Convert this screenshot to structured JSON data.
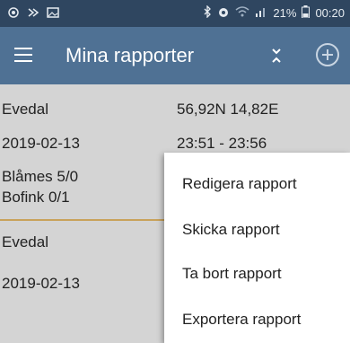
{
  "status_bar": {
    "battery": "21%",
    "time": "00:20",
    "left_icons": [
      "camera-icon",
      "nfc-icon",
      "image-icon"
    ],
    "right_icons": [
      "bluetooth-icon",
      "alarm-icon",
      "wifi-icon",
      "signal-icon",
      "battery-icon"
    ]
  },
  "appbar": {
    "title": "Mina rapporter",
    "menu_icon": "hamburger-menu-icon",
    "sort_icon": "collapse-expand-icon",
    "add_icon": "add-circle-icon",
    "color": "#4f7194"
  },
  "reports": [
    {
      "location": "Evedal",
      "coordinates": "56,92N 14,82E",
      "date": "2019-02-13",
      "time_range": "23:51 - 23:56",
      "species": [
        "Blåmes 5/0",
        "Bofink 0/1"
      ]
    },
    {
      "location": "Evedal",
      "date": "2019-02-13"
    }
  ],
  "context_menu": {
    "items": [
      "Redigera rapport",
      "Skicka rapport",
      "Ta bort rapport",
      "Exportera rapport"
    ]
  }
}
